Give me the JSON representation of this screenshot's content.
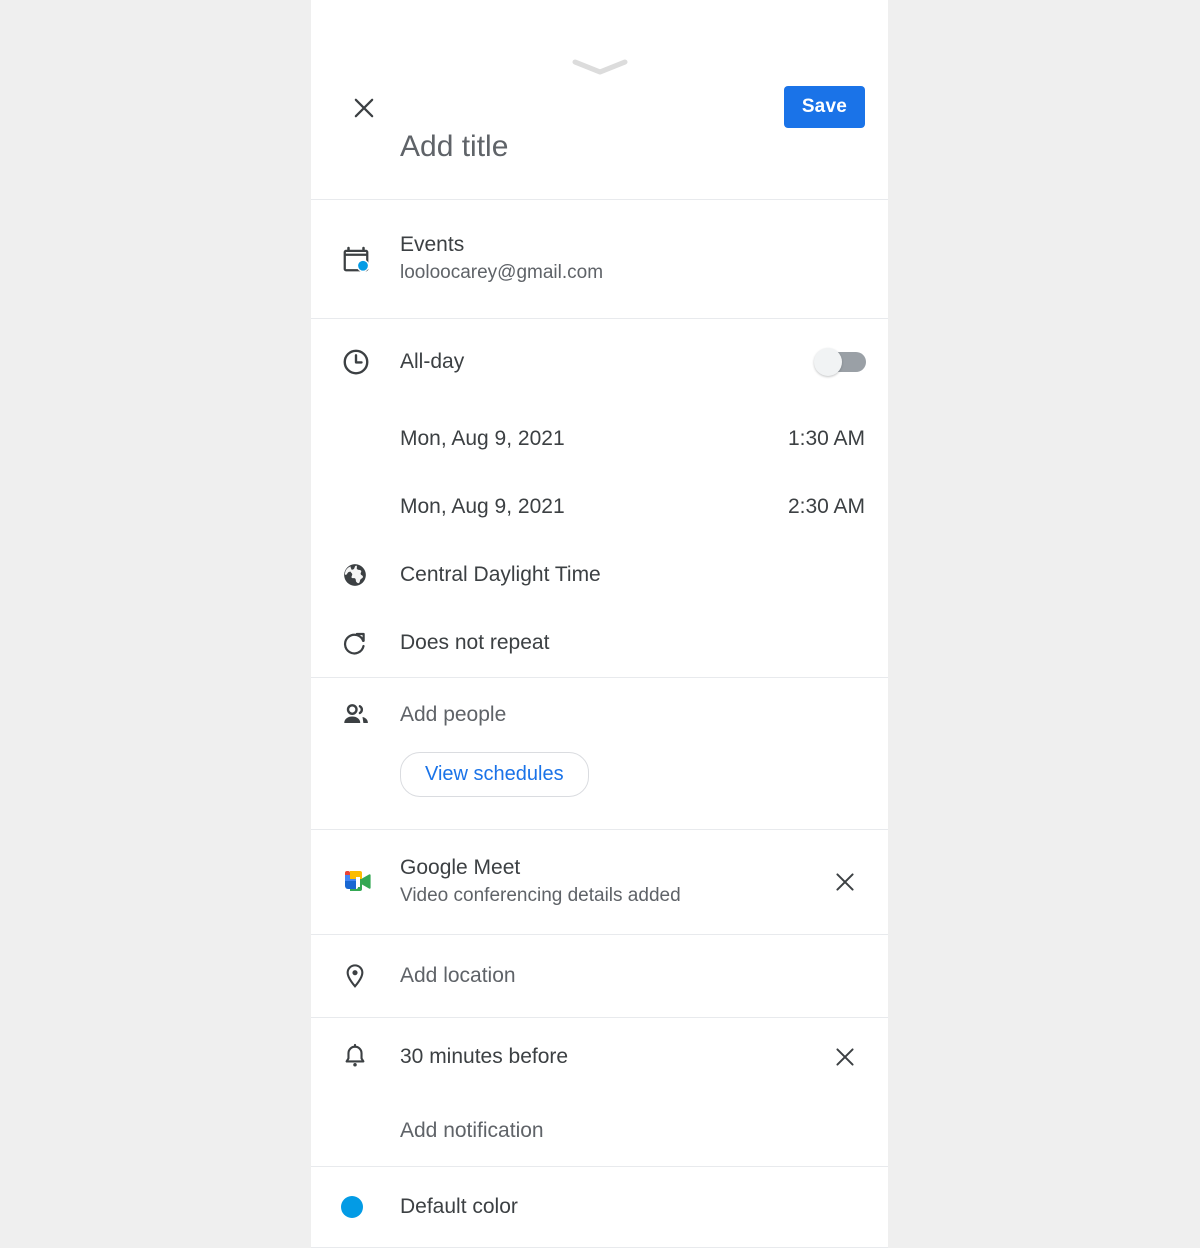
{
  "app": {
    "name": "Google Calendar",
    "screen": "create-event"
  },
  "colors": {
    "accent": "#1a73e8",
    "text_primary": "#3c4043",
    "text_secondary": "#5f6368",
    "divider": "#e8eaed",
    "backdrop": "#efefef",
    "calendar_dot": "#039be5",
    "default_color_dot": "#039be5",
    "toggle_track_off": "#9aa0a6",
    "toggle_knob_off": "#f1f3f4"
  },
  "header": {
    "close_icon": "close-icon",
    "drag_handle_icon": "chevron-down-icon",
    "save_label": "Save",
    "title_value": "",
    "title_placeholder": "Add title"
  },
  "calendar": {
    "icon": "calendar-icon",
    "name": "Events",
    "account": "looloocarey@gmail.com"
  },
  "all_day": {
    "icon": "clock-icon",
    "label": "All-day",
    "enabled": false
  },
  "start": {
    "date": "Mon, Aug 9, 2021",
    "time": "1:30 AM"
  },
  "end": {
    "date": "Mon, Aug 9, 2021",
    "time": "2:30 AM"
  },
  "timezone": {
    "icon": "globe-icon",
    "label": "Central Daylight Time"
  },
  "recurrence": {
    "icon": "repeat-icon",
    "label": "Does not repeat"
  },
  "guests": {
    "icon": "people-icon",
    "add_people_placeholder": "Add people",
    "view_schedules_label": "View schedules"
  },
  "conference": {
    "icon": "google-meet-icon",
    "title": "Google Meet",
    "subtitle": "Video conferencing details added",
    "remove_icon": "close-icon"
  },
  "location": {
    "icon": "location-pin-icon",
    "placeholder": "Add location"
  },
  "notification": {
    "icon": "bell-icon",
    "value": "30 minutes before",
    "remove_icon": "close-icon",
    "add_label": "Add notification"
  },
  "event_color": {
    "icon": "color-dot-icon",
    "label": "Default color"
  }
}
